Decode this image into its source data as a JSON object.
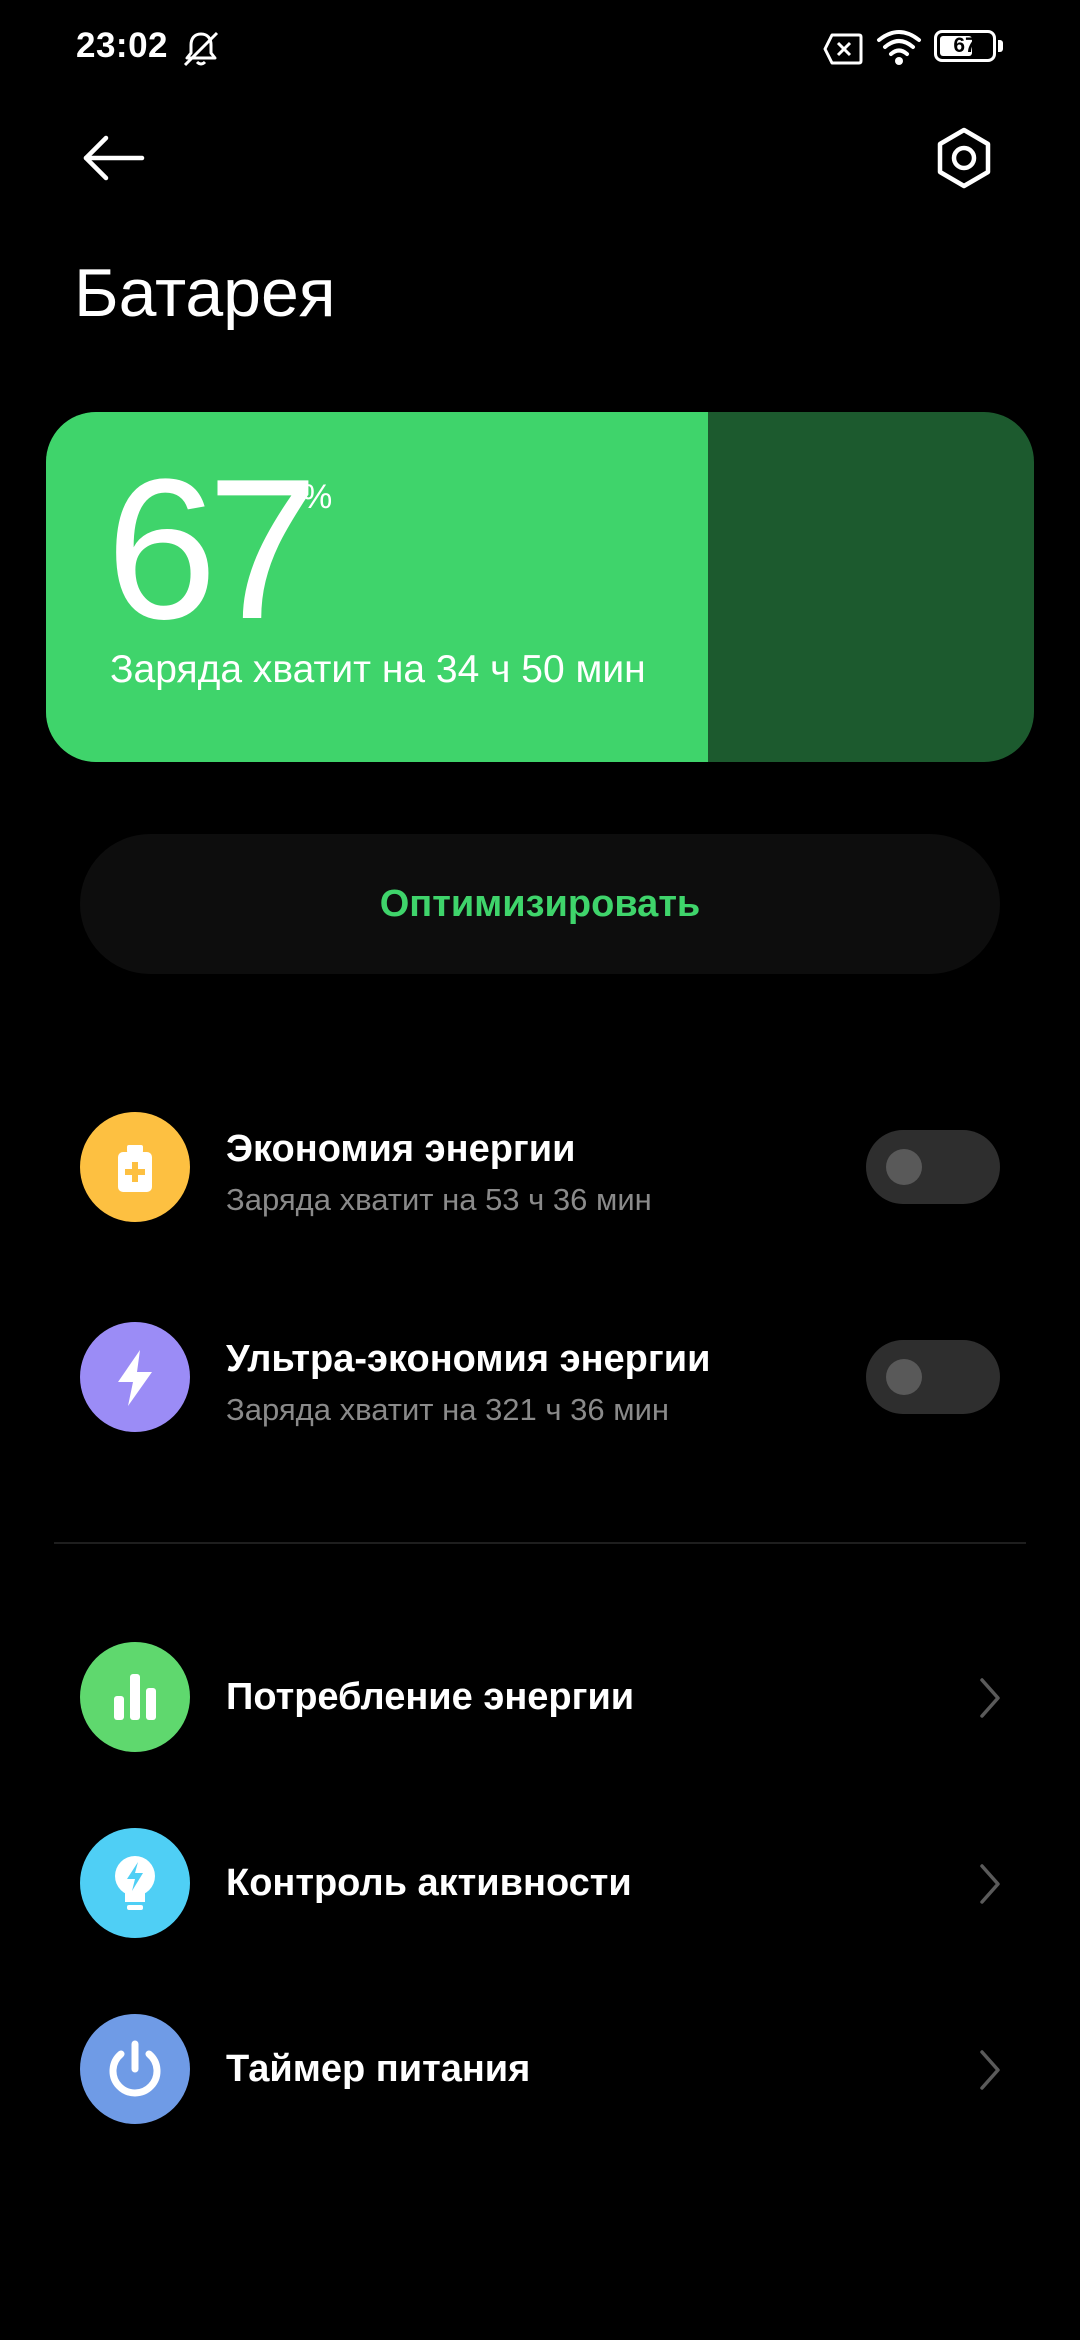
{
  "status_bar": {
    "time": "23:02",
    "battery_level": "67",
    "battery_fraction": 0.67,
    "icons": [
      "mute-notifications-icon",
      "no-sim-icon",
      "wifi-icon",
      "battery-icon"
    ]
  },
  "top_bar": {
    "back_icon": "arrow-left-icon",
    "settings_icon": "gear-hexagon-icon"
  },
  "page": {
    "title": "Батарея"
  },
  "battery_card": {
    "percent": "67",
    "percent_sign": "%",
    "level_fraction": 0.67,
    "remaining": "Заряда хватит на 34 ч 50 мин",
    "fill_color": "#3fd46b",
    "empty_color": "#1c5a2e"
  },
  "optimize": {
    "label": "Оптимизировать",
    "color": "#3fd46b"
  },
  "power_modes": [
    {
      "title": "Экономия энергии",
      "subtitle": "Заряда хватит на 53 ч 36 мин",
      "icon": "battery-plus-icon",
      "icon_color": "#fdc041",
      "enabled": false
    },
    {
      "title": "Ультра-экономия энергии",
      "subtitle": "Заряда хватит на 321 ч 36 мин",
      "icon": "lightning-icon",
      "icon_color": "#9b8cf6",
      "enabled": false
    }
  ],
  "menu": [
    {
      "title": "Потребление энергии",
      "icon": "bar-chart-icon",
      "icon_color": "#5fd86e"
    },
    {
      "title": "Контроль активности",
      "icon": "bulb-bolt-icon",
      "icon_color": "#4fcff5"
    },
    {
      "title": "Таймер питания",
      "icon": "power-icon",
      "icon_color": "#6f9be6"
    }
  ]
}
